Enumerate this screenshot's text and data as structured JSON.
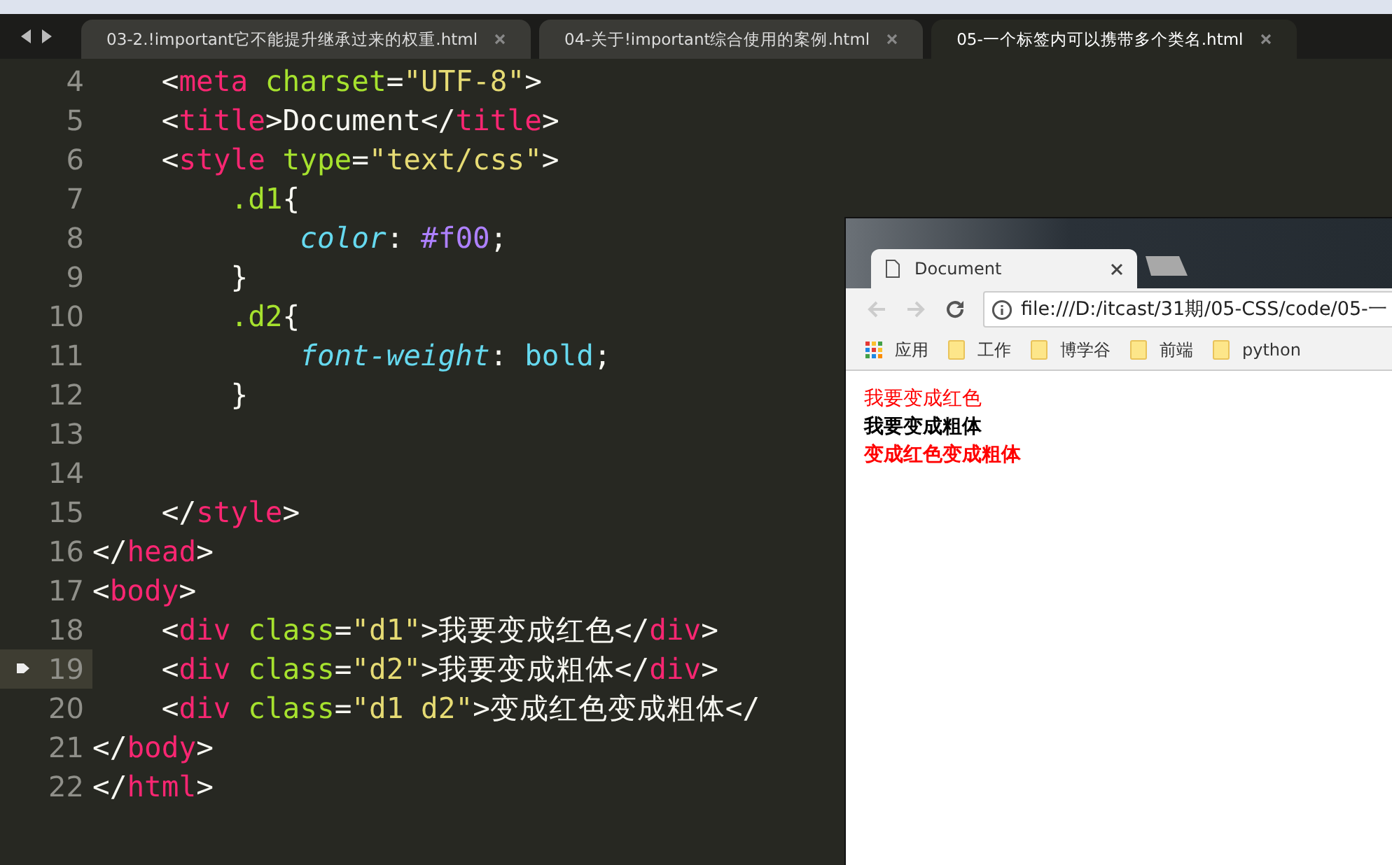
{
  "tabs": [
    {
      "label": "03-2.!important它不能提升继承过来的权重.html",
      "selected": false
    },
    {
      "label": "04-关于!important综合使用的案例.html",
      "selected": false
    },
    {
      "label": "05-一个标签内可以携带多个类名.html",
      "selected": true
    }
  ],
  "code_lines": [
    {
      "number": "4",
      "current": false,
      "tokens": [
        {
          "kind": "punct",
          "text": "    <"
        },
        {
          "kind": "tag",
          "text": "meta"
        },
        {
          "kind": "attr",
          "text": " charset"
        },
        {
          "kind": "punct",
          "text": "="
        },
        {
          "kind": "string",
          "text": "\"UTF-8\""
        },
        {
          "kind": "punct",
          "text": ">"
        }
      ]
    },
    {
      "number": "5",
      "current": false,
      "tokens": [
        {
          "kind": "punct",
          "text": "    <"
        },
        {
          "kind": "tag",
          "text": "title"
        },
        {
          "kind": "punct",
          "text": ">"
        },
        {
          "kind": "text",
          "text": "Document"
        },
        {
          "kind": "punct",
          "text": "</"
        },
        {
          "kind": "tag",
          "text": "title"
        },
        {
          "kind": "punct",
          "text": ">"
        }
      ]
    },
    {
      "number": "6",
      "current": false,
      "tokens": [
        {
          "kind": "punct",
          "text": "    <"
        },
        {
          "kind": "tag",
          "text": "style"
        },
        {
          "kind": "attr",
          "text": " type"
        },
        {
          "kind": "punct",
          "text": "="
        },
        {
          "kind": "string",
          "text": "\"text/css\""
        },
        {
          "kind": "punct",
          "text": ">"
        }
      ]
    },
    {
      "number": "7",
      "current": false,
      "tokens": [
        {
          "kind": "selector",
          "text": "        .d1"
        },
        {
          "kind": "punct",
          "text": "{"
        }
      ]
    },
    {
      "number": "8",
      "current": false,
      "tokens": [
        {
          "kind": "property",
          "text": "            color"
        },
        {
          "kind": "punct",
          "text": ": "
        },
        {
          "kind": "value",
          "text": "#f00"
        },
        {
          "kind": "punct",
          "text": ";"
        }
      ]
    },
    {
      "number": "9",
      "current": false,
      "tokens": [
        {
          "kind": "punct",
          "text": "        }"
        }
      ]
    },
    {
      "number": "10",
      "current": false,
      "tokens": [
        {
          "kind": "selector",
          "text": "        .d2"
        },
        {
          "kind": "punct",
          "text": "{"
        }
      ]
    },
    {
      "number": "11",
      "current": false,
      "tokens": [
        {
          "kind": "property",
          "text": "            font-weight"
        },
        {
          "kind": "punct",
          "text": ": "
        },
        {
          "kind": "keyword",
          "text": "bold"
        },
        {
          "kind": "punct",
          "text": ";"
        }
      ]
    },
    {
      "number": "12",
      "current": false,
      "tokens": [
        {
          "kind": "punct",
          "text": "        }"
        }
      ]
    },
    {
      "number": "13",
      "current": false
    },
    {
      "number": "14",
      "current": false
    },
    {
      "number": "15",
      "current": false,
      "tokens": [
        {
          "kind": "punct",
          "text": "    </"
        },
        {
          "kind": "tag",
          "text": "style"
        },
        {
          "kind": "punct",
          "text": ">"
        }
      ]
    },
    {
      "number": "16",
      "current": false,
      "tokens": [
        {
          "kind": "punct",
          "text": "</"
        },
        {
          "kind": "tag",
          "text": "head"
        },
        {
          "kind": "punct",
          "text": ">"
        }
      ]
    },
    {
      "number": "17",
      "current": false,
      "tokens": [
        {
          "kind": "punct",
          "text": "<"
        },
        {
          "kind": "tag",
          "text": "body"
        },
        {
          "kind": "punct",
          "text": ">"
        }
      ]
    },
    {
      "number": "18",
      "current": false,
      "tokens": [
        {
          "kind": "punct",
          "text": "    <"
        },
        {
          "kind": "tag",
          "text": "div"
        },
        {
          "kind": "attr",
          "text": " class"
        },
        {
          "kind": "punct",
          "text": "="
        },
        {
          "kind": "string",
          "text": "\"d1\""
        },
        {
          "kind": "punct",
          "text": ">"
        },
        {
          "kind": "text",
          "text": "我要变成红色"
        },
        {
          "kind": "punct",
          "text": "</"
        },
        {
          "kind": "tag",
          "text": "div"
        },
        {
          "kind": "punct",
          "text": ">"
        }
      ]
    },
    {
      "number": "19",
      "current": true,
      "tokens": [
        {
          "kind": "punct",
          "text": "    <"
        },
        {
          "kind": "tag",
          "text": "div"
        },
        {
          "kind": "attr",
          "text": " class"
        },
        {
          "kind": "punct",
          "text": "="
        },
        {
          "kind": "string",
          "text": "\"d2\""
        },
        {
          "kind": "punct",
          "text": ">"
        },
        {
          "kind": "text",
          "text": "我要变成粗体"
        },
        {
          "kind": "punct",
          "text": "</"
        },
        {
          "kind": "tag",
          "text": "div"
        },
        {
          "kind": "punct",
          "text": ">"
        }
      ]
    },
    {
      "number": "20",
      "current": false,
      "tokens": [
        {
          "kind": "punct",
          "text": "    <"
        },
        {
          "kind": "tag",
          "text": "div"
        },
        {
          "kind": "attr",
          "text": " class"
        },
        {
          "kind": "punct",
          "text": "="
        },
        {
          "kind": "string",
          "text": "\"d1 d2\""
        },
        {
          "kind": "punct",
          "text": ">"
        },
        {
          "kind": "text",
          "text": "变成红色变成粗体"
        },
        {
          "kind": "punct",
          "text": "</"
        }
      ]
    },
    {
      "number": "21",
      "current": false,
      "tokens": [
        {
          "kind": "punct",
          "text": "</"
        },
        {
          "kind": "tag",
          "text": "body"
        },
        {
          "kind": "punct",
          "text": ">"
        }
      ]
    },
    {
      "number": "22",
      "current": false,
      "tokens": [
        {
          "kind": "punct",
          "text": "</"
        },
        {
          "kind": "tag",
          "text": "html"
        },
        {
          "kind": "punct",
          "text": ">"
        }
      ]
    }
  ],
  "browser": {
    "tab_title": "Document",
    "address": "file:///D:/itcast/31期/05-CSS/code/05-一",
    "bookmarks": [
      {
        "kind": "apps",
        "label": "应用"
      },
      {
        "kind": "folder",
        "label": "工作"
      },
      {
        "kind": "folder",
        "label": "博学谷"
      },
      {
        "kind": "folder",
        "label": "前端"
      },
      {
        "kind": "folder",
        "label": "python"
      }
    ],
    "content": [
      {
        "text": "我要变成红色",
        "color": "#ff0000",
        "bold": false
      },
      {
        "text": "我要变成粗体",
        "color": "#000000",
        "bold": true
      },
      {
        "text": "变成红色变成粗体",
        "color": "#ff0000",
        "bold": true
      }
    ]
  }
}
